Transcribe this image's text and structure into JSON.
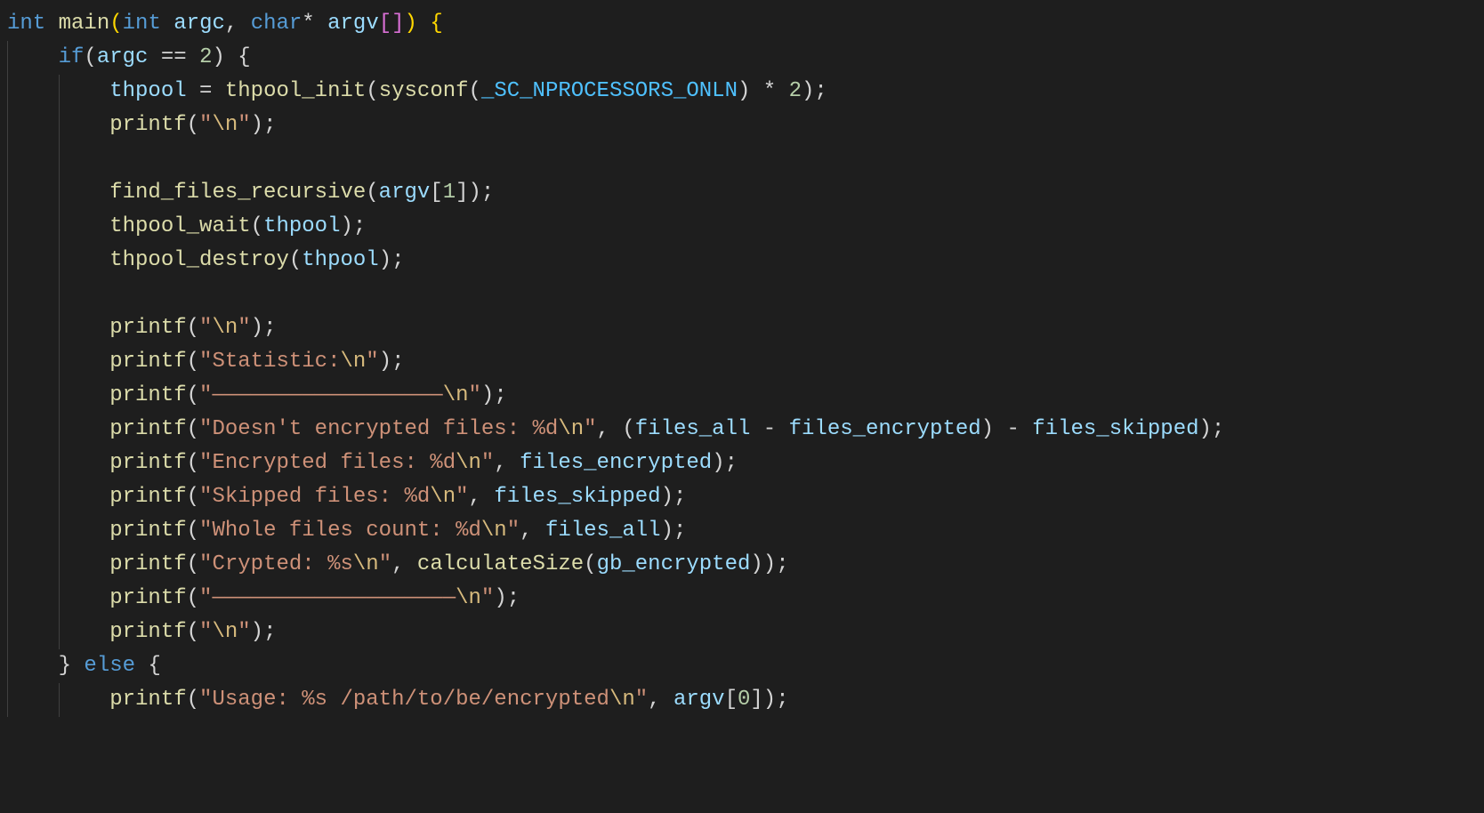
{
  "tokens": {
    "kw_int": "int",
    "main": "main",
    "argc": "argc",
    "kw_char": "char",
    "argv": "argv",
    "kw_if": "if",
    "kw_else": "else",
    "eq2": "2",
    "thpool": "thpool",
    "thpool_init": "thpool_init",
    "sysconf": "sysconf",
    "sc_np": "_SC_NPROCESSORS_ONLN",
    "mult2": "2",
    "printf": "printf",
    "find_files_recursive": "find_files_recursive",
    "idx1": "1",
    "thpool_wait": "thpool_wait",
    "thpool_destroy": "thpool_destroy",
    "files_all": "files_all",
    "files_encrypted": "files_encrypted",
    "files_skipped": "files_skipped",
    "calculateSize": "calculateSize",
    "gb_encrypted": "gb_encrypted",
    "idx0": "0"
  },
  "strings": {
    "nl": "\\n",
    "stat_pre": "Statistic:",
    "line_pre": "——————————————————",
    "didnt_pre": "Doesn't encrypted files: %d",
    "enc_pre": "Encrypted files: %d",
    "skip_pre": "Skipped files: %d",
    "whole_pre": "Whole files count: %d",
    "crypt_pre": "Crypted: %s",
    "line2_pre": "———————————————————",
    "usage_pre": "Usage: %s /path/to/be/encrypted"
  }
}
